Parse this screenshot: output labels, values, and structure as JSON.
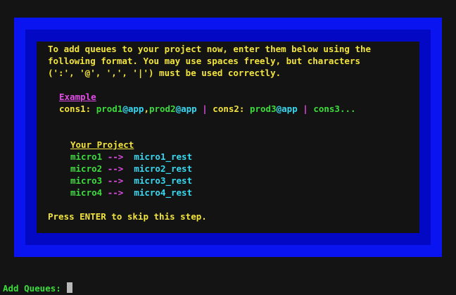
{
  "intro": {
    "line1": "To add queues to your project now, enter them below using the",
    "line2": "following format. You may use spaces freely, but characters",
    "line3": "(':', '@', ',', '|') must be used correctly."
  },
  "example": {
    "heading": "Example",
    "cons1_label": "cons1:",
    "prod1": "prod1",
    "app1": "@app",
    "comma": ",",
    "prod2": "prod2",
    "app2": "@app",
    "pipe1": " | ",
    "cons2_label": "cons2:",
    "prod3": "prod3",
    "app3": "@app",
    "pipe2": " | ",
    "cons3": "cons3..."
  },
  "project": {
    "heading": "Your Project",
    "arrow": "-->",
    "mappings": [
      {
        "source": "micro1",
        "target": "micro1_rest"
      },
      {
        "source": "micro2",
        "target": "micro2_rest"
      },
      {
        "source": "micro3",
        "target": "micro3_rest"
      },
      {
        "source": "micro4",
        "target": "micro4_rest"
      }
    ]
  },
  "skip_hint": "Press ENTER to skip this step.",
  "prompt": {
    "label": "Add Queues:",
    "value": ""
  },
  "colors": {
    "frame_outer": "#0a14f0",
    "frame_inner": "#0208c4",
    "background": "#141414",
    "yellow": "#f2e43c",
    "magenta": "#e24ce6",
    "green": "#3ddc3d",
    "cyan": "#38d8f0"
  }
}
